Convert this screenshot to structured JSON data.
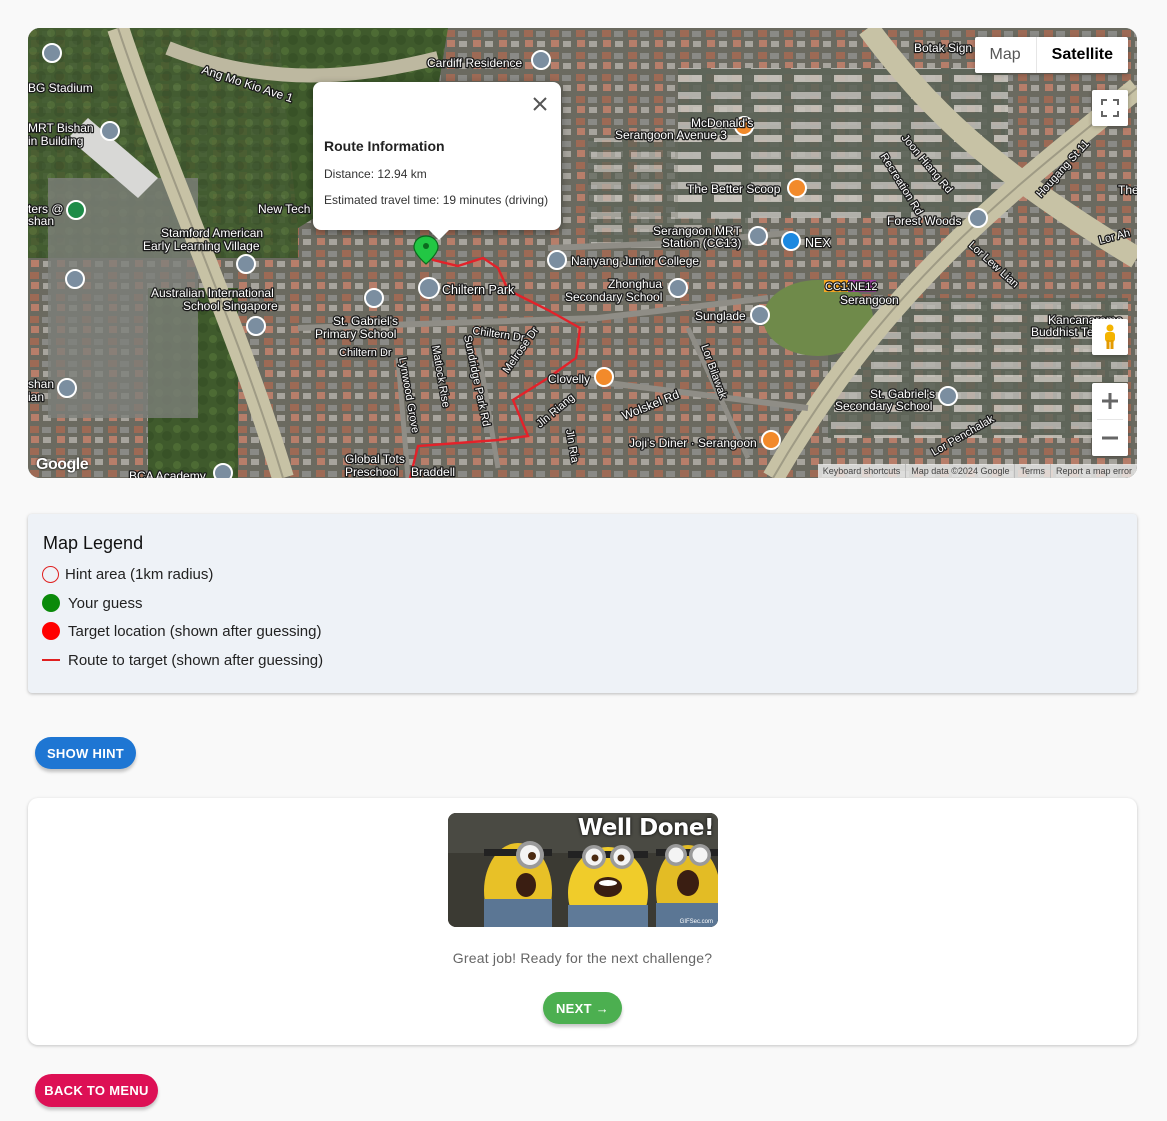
{
  "map": {
    "type_control": {
      "map_label": "Map",
      "satellite_label": "Satellite",
      "selected": "Satellite"
    },
    "controls": {
      "fullscreen_icon": "fullscreen-icon",
      "pegman_icon": "pegman-icon",
      "zoom_in_label": "+",
      "zoom_out_label": "−"
    },
    "google_logo": "Google",
    "attribution": [
      "Keyboard shortcuts",
      "Map data ©2024 Google",
      "Terms",
      "Report a map error"
    ],
    "labels": {
      "stadium": "BG Stadium",
      "ang_mo_kio": "Ang Mo Kio Ave 1",
      "cardiff": "Cardiff Residence",
      "mrt_bishan_1": "MRT Bishan",
      "mrt_bishan_2": "in Building",
      "new_tech": "New Tech",
      "stamford_1": "Stamford American",
      "stamford_2": "Early Learning Village",
      "australian_1": "Australian International",
      "australian_2": "School Singapore",
      "st_gabriel_p1": "St. Gabriel's",
      "st_gabriel_p2": "Primary School",
      "chiltern_park": "Chiltern Park",
      "chiltern_dr": "Chiltern Dr",
      "chiltern_dr2": "Chiltern Dr",
      "lynwood": "Lynwood Grove",
      "matlock": "Matlock Rise",
      "sundridge": "Sundridge Park Rd",
      "melrose": "Melrose Dr",
      "global_tots_1": "Global Tots",
      "global_tots_2": "Preschool",
      "braddell": "Braddell",
      "bca": "BCA Academy",
      "clovelly": "Clovelly",
      "jln_riang": "Jln Riang",
      "jln_ria": "Jln Ria",
      "wolskel": "Wolskel Rd",
      "jojis": "Joji's Diner · Serangoon",
      "nanyang": "Nanyang Junior College",
      "zhonghua_1": "Zhonghua",
      "zhonghua_2": "Secondary School",
      "serangoon_mrt_1": "Serangoon MRT",
      "serangoon_mrt_2": "Station (CC13)",
      "nex": "NEX",
      "serangoon": "Serangoon",
      "sunglade": "Sunglade",
      "lor_bilawak": "Lor Bilawak",
      "better_scoop": "The Better Scoop",
      "mcdonalds_1": "McDonald's",
      "mcdonalds_2": "Serangoon Avenue 3",
      "forest_woods": "Forest Woods",
      "joon_hiang": "Joon Hiang Rd",
      "recreation": "Recreation Rd",
      "hougang": "Hougang St 11",
      "lor_lew_lian": "Lor Lew Lian",
      "lor_ah": "Lor Ah",
      "botak": "Botak Sign",
      "kancanarama_1": "Kancanarama",
      "kancanarama_2": "Buddhist Temple",
      "st_gabriel_s1": "St. Gabriel's",
      "st_gabriel_s2": "Secondary School",
      "lor_penchalak": "Lor Penchalak",
      "the": "The",
      "shan": "shan",
      "ian": "ian",
      "ters": "ters @",
      "shan2": "shan",
      "cc13": "CC13",
      "ne12": "NE12"
    },
    "info_window": {
      "title": "Route Information",
      "distance": "Distance: 12.94 km",
      "travel_time": "Estimated travel time: 19 minutes (driving)",
      "close_icon": "close-icon"
    }
  },
  "legend": {
    "title": "Map Legend",
    "items": [
      {
        "label": "Hint area (1km radius)",
        "swatch": "hollow-red-circle",
        "color": "#e02020"
      },
      {
        "label": "Your guess",
        "swatch": "green-dot",
        "color": "#0a8a0a"
      },
      {
        "label": "Target location (shown after guessing)",
        "swatch": "red-dot",
        "color": "#ff0000"
      },
      {
        "label": "Route to target (shown after guessing)",
        "swatch": "red-line",
        "color": "#e02020"
      }
    ]
  },
  "buttons": {
    "show_hint": "SHOW HINT",
    "back_to_menu": "BACK TO MENU"
  },
  "success": {
    "gif_caption": "Well Done!",
    "gif_credit": "GIFSec.com",
    "message": "Great job! Ready for the next challenge?",
    "next_label": "NEXT →"
  },
  "colors": {
    "hint_button": "#1e76d3",
    "back_button": "#dd1055",
    "next_button": "#4caf50",
    "route": "#e02020",
    "guess_marker": "#22c744"
  }
}
